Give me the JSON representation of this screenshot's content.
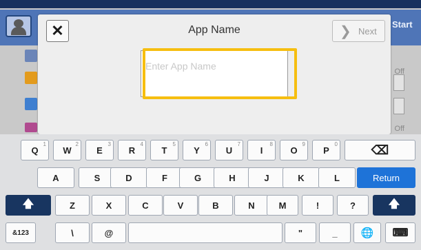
{
  "background": {
    "start_label": "Start",
    "off_labels": [
      "Off",
      "Off"
    ]
  },
  "dialog": {
    "title": "App Name",
    "close_glyph": "✕",
    "next_label": "Next",
    "next_glyph": "❯",
    "input": {
      "placeholder": "Enter App Name",
      "value": ""
    }
  },
  "keyboard": {
    "row1": [
      {
        "label": "Q",
        "alt": "1"
      },
      {
        "label": "W",
        "alt": "2"
      },
      {
        "label": "E",
        "alt": "3"
      },
      {
        "label": "R",
        "alt": "4"
      },
      {
        "label": "T",
        "alt": "5"
      },
      {
        "label": "Y",
        "alt": "6"
      },
      {
        "label": "U",
        "alt": "7"
      },
      {
        "label": "I",
        "alt": "8"
      },
      {
        "label": "O",
        "alt": "9"
      },
      {
        "label": "P",
        "alt": "0"
      }
    ],
    "backspace_glyph": "⌫",
    "row2": [
      "A",
      "S",
      "D",
      "F",
      "G",
      "H",
      "J",
      "K",
      "L"
    ],
    "return_label": "Return",
    "shift_glyph": "🡅",
    "row3": [
      "Z",
      "X",
      "C",
      "V",
      "B",
      "N",
      "M",
      "!",
      "?"
    ],
    "row4": {
      "symbols_label": "&123",
      "backslash": "\\",
      "at": "@",
      "quote": "\"",
      "underscore": "_",
      "globe_glyph": "🌐",
      "keyboard_glyph": "⌨"
    }
  },
  "colors": {
    "accent_blue": "#1e73d8",
    "focus_yellow": "#f6be10",
    "shift_navy": "#183560"
  }
}
